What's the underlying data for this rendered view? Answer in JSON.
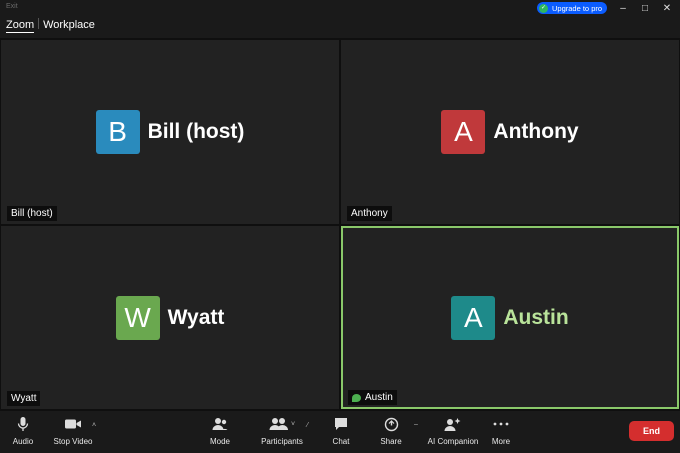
{
  "window": {
    "title": "Exit",
    "upgrade_label": "Upgrade to pro",
    "minimize_glyph": "–",
    "maximize_glyph": "□",
    "close_glyph": "✕"
  },
  "brand": {
    "zoom": "Zoom",
    "workplace": "Workplace"
  },
  "participants": [
    {
      "initial": "B",
      "name": "Bill (host)",
      "label": "Bill (host)",
      "color": "#2a8bbd"
    },
    {
      "initial": "A",
      "name": "Anthony",
      "label": "Anthony",
      "color": "#c0393b"
    },
    {
      "initial": "W",
      "name": "Wyatt",
      "label": "Wyatt",
      "color": "#6aa84f"
    },
    {
      "initial": "A",
      "name": "Austin",
      "label": "Austin",
      "color": "#1e8a8a",
      "active_speaker": true,
      "highlight_color": "#8ac86a"
    }
  ],
  "toolbar": {
    "audio": "Audio",
    "stop_video": "Stop Video",
    "mode": "Mode",
    "participants": "Participants",
    "chat": "Chat",
    "share": "Share",
    "ai_companion": "AI Companion",
    "more": "More",
    "end": "End"
  },
  "colors": {
    "end_button": "#d42e2e",
    "upgrade_button": "#0b5cff"
  }
}
